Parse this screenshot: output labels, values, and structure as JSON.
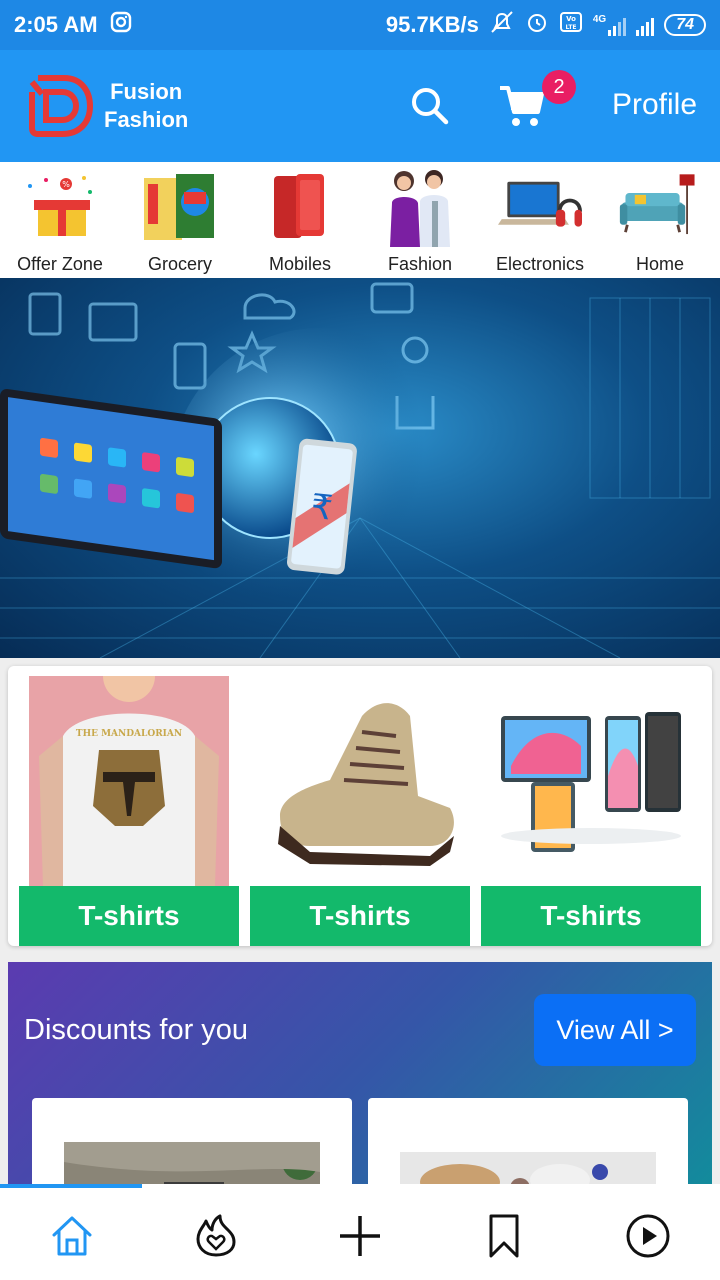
{
  "status_bar": {
    "time": "2:05 AM",
    "speed": "95.7KB/s",
    "network": "4G",
    "battery": "74"
  },
  "app_bar": {
    "brand_line1": "Fusion",
    "brand_line2": "Fashion",
    "cart_count": "2",
    "profile_label": "Profile"
  },
  "categories": [
    {
      "label": "Offer Zone"
    },
    {
      "label": "Grocery"
    },
    {
      "label": "Mobiles"
    },
    {
      "label": "Fashion"
    },
    {
      "label": "Electronics"
    },
    {
      "label": "Home"
    }
  ],
  "products": [
    {
      "label": "T-shirts",
      "shirt_text": "THE MANDALORIAN"
    },
    {
      "label": "T-shirts"
    },
    {
      "label": "T-shirts"
    }
  ],
  "discounts": {
    "title": "Discounts for you",
    "view_all": "View All >"
  },
  "colors": {
    "primary": "#2196f3",
    "status_bar": "#1e88e5",
    "badge": "#e91e63",
    "product_label": "#13b96b",
    "view_all": "#0b6ff5"
  },
  "bottom_nav": [
    {
      "icon": "home-icon",
      "active": true
    },
    {
      "icon": "trending-icon"
    },
    {
      "icon": "add-icon"
    },
    {
      "icon": "bookmark-icon"
    },
    {
      "icon": "play-icon"
    }
  ]
}
